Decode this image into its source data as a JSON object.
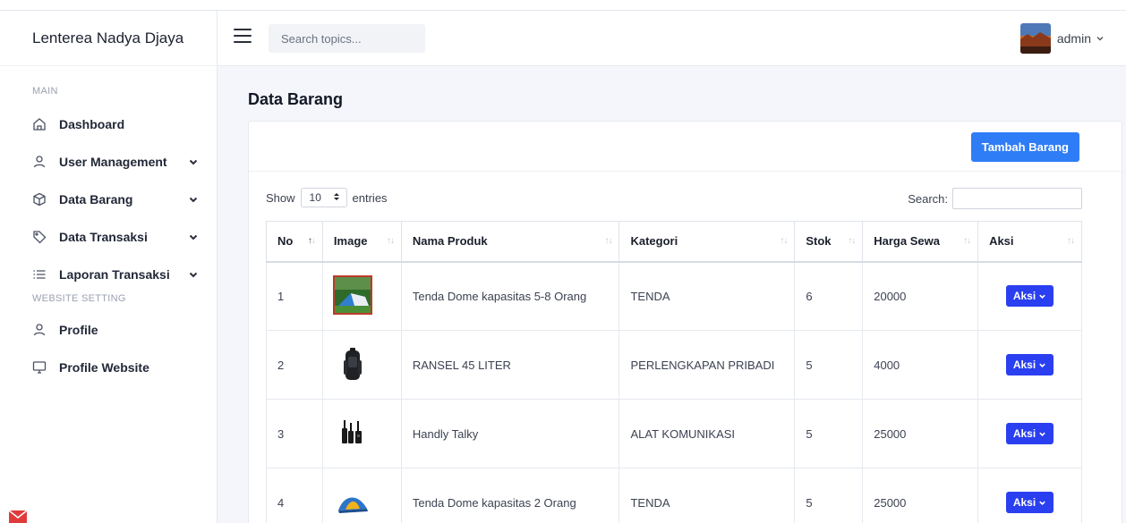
{
  "app": {
    "brand": "Lenterea Nadya Djaya"
  },
  "sidebar": {
    "sections": {
      "main": "MAIN",
      "website": "WEBSITE SETTING"
    },
    "items": [
      {
        "label": "Dashboard",
        "icon": "home-icon",
        "has_children": false
      },
      {
        "label": "User Management",
        "icon": "user-icon",
        "has_children": true
      },
      {
        "label": "Data Barang",
        "icon": "box-icon",
        "has_children": true
      },
      {
        "label": "Data Transaksi",
        "icon": "tag-icon",
        "has_children": true
      },
      {
        "label": "Laporan Transaksi",
        "icon": "list-icon",
        "has_children": true
      },
      {
        "label": "Profile",
        "icon": "user-icon",
        "has_children": false
      },
      {
        "label": "Profile Website",
        "icon": "monitor-icon",
        "has_children": false
      }
    ]
  },
  "header": {
    "search_placeholder": "Search topics...",
    "user_name": "admin"
  },
  "page": {
    "title": "Data Barang"
  },
  "card": {
    "add_button": "Tambah Barang",
    "show_label": "Show",
    "entries_value": "10",
    "entries_label": "entries",
    "search_label": "Search:"
  },
  "table": {
    "columns": [
      "No",
      "Image",
      "Nama Produk",
      "Kategori",
      "Stok",
      "Harga Sewa",
      "Aksi"
    ],
    "rows": [
      {
        "no": "1",
        "image": "tent-photo",
        "nama": "Tenda Dome kapasitas 5-8 Orang",
        "kategori": "TENDA",
        "stok": "6",
        "harga": "20000",
        "aksi": "Aksi"
      },
      {
        "no": "2",
        "image": "backpack-photo",
        "nama": "RANSEL 45 LITER",
        "kategori": "PERLENGKAPAN PRIBADI",
        "stok": "5",
        "harga": "4000",
        "aksi": "Aksi"
      },
      {
        "no": "3",
        "image": "walkie-talkie-photo",
        "nama": "Handly Talky",
        "kategori": "ALAT KOMUNIKASI",
        "stok": "5",
        "harga": "25000",
        "aksi": "Aksi"
      },
      {
        "no": "4",
        "image": "dome-tent-photo",
        "nama": "Tenda Dome kapasitas 2 Orang",
        "kategori": "TENDA",
        "stok": "5",
        "harga": "25000",
        "aksi": "Aksi"
      }
    ]
  },
  "colors": {
    "primary": "#2f7df6",
    "aksi": "#2a3ff0",
    "background": "#f4f6fb"
  }
}
